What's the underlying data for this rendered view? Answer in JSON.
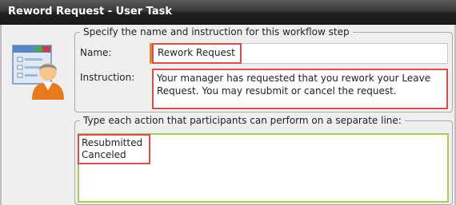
{
  "window": {
    "title": "Reword Request - User Task"
  },
  "step_group": {
    "legend": "Specify the name and instruction for this workflow step",
    "name_label": "Name:",
    "name_value": "Rework Request",
    "instruction_label": "Instruction:",
    "instruction_value": "Your manager has requested that you rework your Leave Request. You may resubmit or cancel the request."
  },
  "actions_group": {
    "legend": "Type each action that participants can perform on a separate line:",
    "actions_value": "Resubmitted\nCanceled"
  },
  "icons": {
    "user_task": "user-task-icon"
  },
  "colors": {
    "highlight": "#d94d4d",
    "focus_border": "#a8cc55",
    "required_marker": "#e08a2b"
  }
}
